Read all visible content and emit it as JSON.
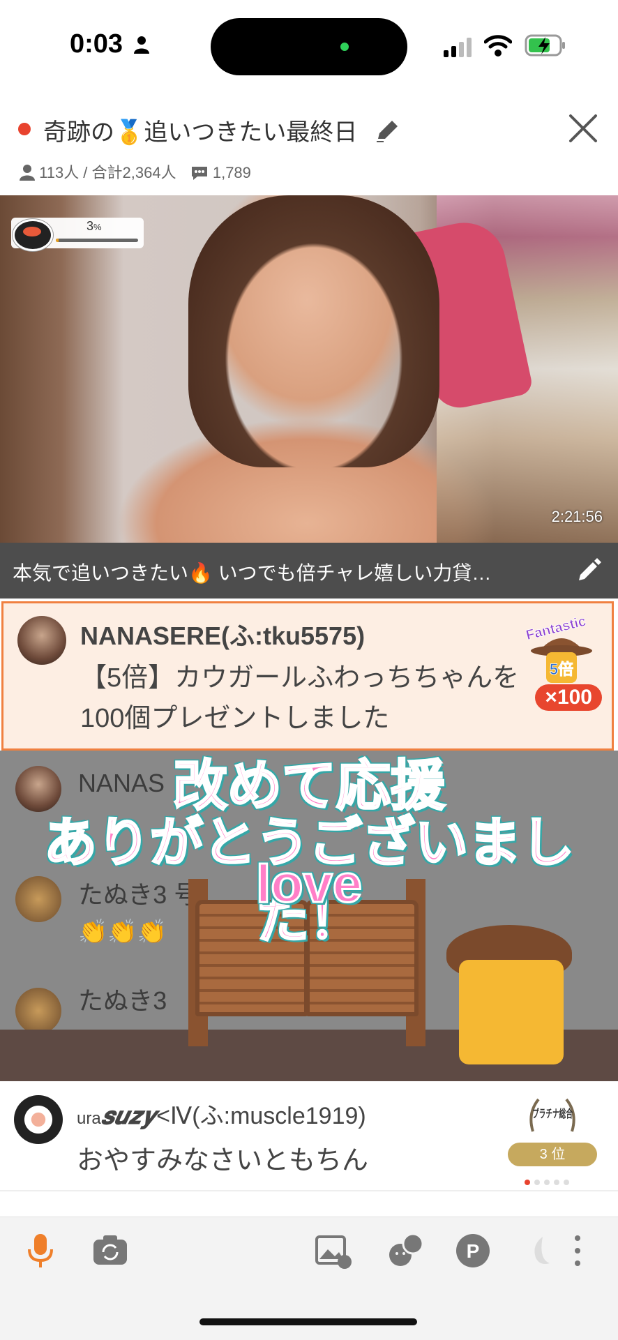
{
  "status_bar": {
    "time": "0:03"
  },
  "header": {
    "title": "奇跡の🥇追いつきたい最終日",
    "viewers": "113人 / 合計2,364人",
    "comments": "1,789"
  },
  "video": {
    "progress_percent_label": "3",
    "progress_percent_unit": "%",
    "progress_fraction": 0.03,
    "elapsed": "2:21:56"
  },
  "description": "本気で追いつきたい🔥 いつでも倍チャレ嬉しい力貸…",
  "gift_comment": {
    "user": "NANASERE(ふ:tku5575)",
    "message": "【5倍】カウガールふわっちちゃんを100個プレゼントしました",
    "badge_top": "Fantastic",
    "badge_mult": "5倍",
    "count": "×100"
  },
  "dim_comments": [
    {
      "user": "NANAS"
    },
    {
      "user": "たぬき3",
      "suffix": "号"
    },
    {
      "user": "たぬき3"
    }
  ],
  "overlay": {
    "line1": "改めて応援",
    "line2": "ありがとうございました！",
    "line3": "love"
  },
  "comment": {
    "user_prefix": "ura",
    "user_styled": "𝒔𝒖𝒛𝒚",
    "user_rest": "<Ⅳ(ふ:muscle1919)",
    "message": "おやすみなさいともちん",
    "rank_badge": "プラチナ総合",
    "rank": "3 位"
  },
  "toolbar": {
    "icons": [
      "microphone-icon",
      "camera-switch-icon",
      "image-icon",
      "emoji-icon",
      "points-icon",
      "more-icon"
    ],
    "points_label": "P"
  },
  "colors": {
    "accent": "#e8432e",
    "gift_border": "#f08040",
    "overlay_pink": "#ff7fc8"
  }
}
